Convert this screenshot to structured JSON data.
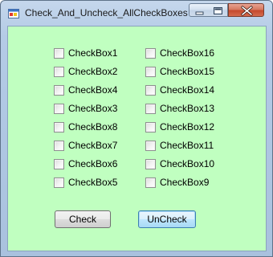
{
  "window": {
    "title": "Check_And_Uncheck_AllCheckBoxes",
    "icon": "winforms-app-icon",
    "controls": [
      "minimize-icon",
      "maximize-icon",
      "close-icon"
    ],
    "client_background": "#c0ffc0"
  },
  "checkboxes": {
    "left_column": [
      {
        "label": "CheckBox1",
        "checked": false
      },
      {
        "label": "CheckBox2",
        "checked": false
      },
      {
        "label": "CheckBox4",
        "checked": false
      },
      {
        "label": "CheckBox3",
        "checked": false
      },
      {
        "label": "CheckBox8",
        "checked": false
      },
      {
        "label": "CheckBox7",
        "checked": false
      },
      {
        "label": "CheckBox6",
        "checked": false
      },
      {
        "label": "CheckBox5",
        "checked": false
      }
    ],
    "right_column": [
      {
        "label": "CheckBox16",
        "checked": false
      },
      {
        "label": "CheckBox15",
        "checked": false
      },
      {
        "label": "CheckBox14",
        "checked": false
      },
      {
        "label": "CheckBox13",
        "checked": false
      },
      {
        "label": "CheckBox12",
        "checked": false
      },
      {
        "label": "CheckBox11",
        "checked": false
      },
      {
        "label": "CheckBox10",
        "checked": false
      },
      {
        "label": "CheckBox9",
        "checked": false
      }
    ]
  },
  "buttons": {
    "check_label": "Check",
    "uncheck_label": "UnCheck"
  }
}
